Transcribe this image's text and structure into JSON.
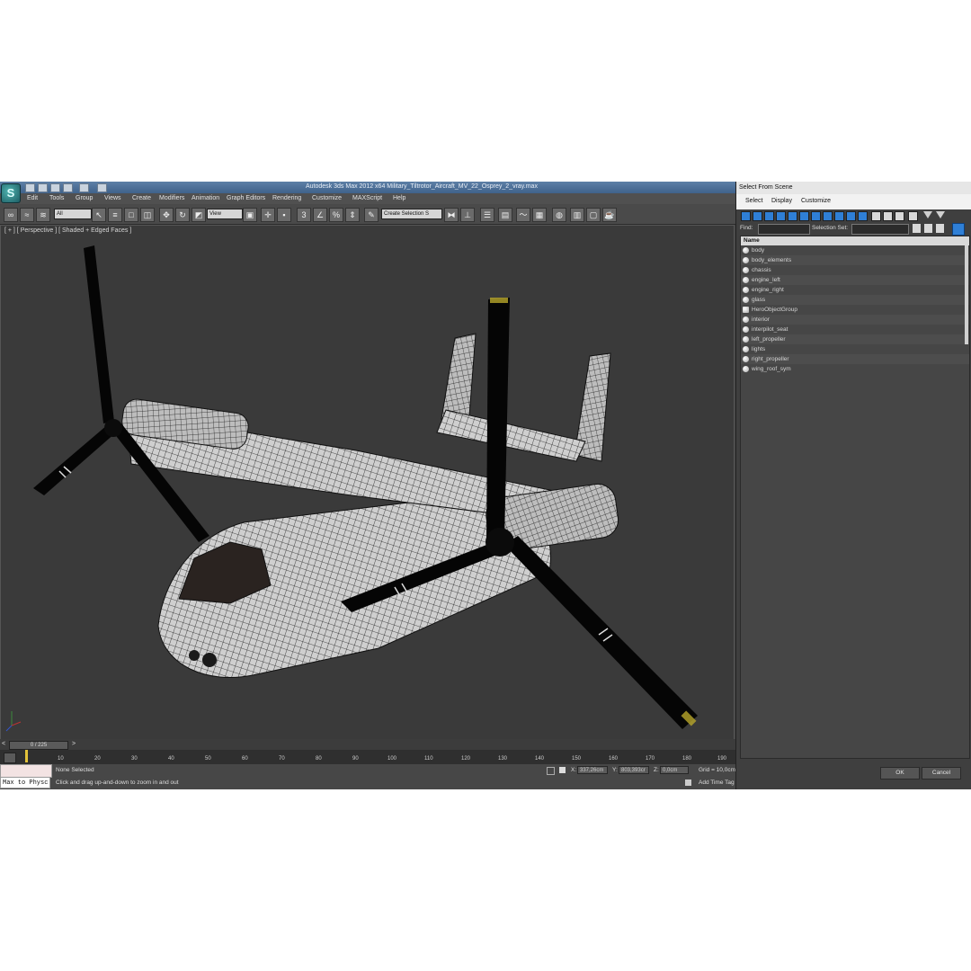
{
  "window": {
    "title": "Autodesk 3ds Max 2012 x64      Military_Tiltrotor_Aircraft_MV_22_Osprey_2_vray.max"
  },
  "menu": [
    "Edit",
    "Tools",
    "Group",
    "Views",
    "Create",
    "Modifiers",
    "Animation",
    "Graph Editors",
    "Rendering",
    "Customize",
    "MAXScript",
    "Help"
  ],
  "toolbar": {
    "filter_value": "All",
    "reference_coord": "View",
    "named_selection_placeholder": "Create Selection S"
  },
  "viewport": {
    "label": "[ + ] [ Perspective ] [ Shaded + Edged Faces ]"
  },
  "timeline": {
    "slider_text": "0 / 225",
    "ticks": [
      "10",
      "20",
      "30",
      "40",
      "50",
      "60",
      "70",
      "80",
      "90",
      "100",
      "110",
      "120",
      "130",
      "140",
      "150",
      "160",
      "170",
      "180",
      "190"
    ]
  },
  "status": {
    "selection": "None Selected",
    "prompt": "Click and drag up-and-down to zoom in and out",
    "maxscript_text": "Max to Physc",
    "x_label": "X:",
    "x_value": "337,26cm",
    "y_label": "Y:",
    "y_value": "803,393cr",
    "z_label": "Z:",
    "z_value": "0,0cm",
    "grid": "Grid = 10,0cm",
    "add_time_tag": "Add Time Tag"
  },
  "dialog": {
    "title": "Select From Scene",
    "menu": [
      "Select",
      "Display",
      "Customize"
    ],
    "find_label": "Find:",
    "selection_set_label": "Selection Set:",
    "column_header": "Name",
    "items": [
      "body",
      "body_elements",
      "chassis",
      "engine_left",
      "engine_right",
      "glass",
      "HeroObjectGroup",
      "interior",
      "interpilot_seat",
      "left_propeller",
      "lights",
      "right_propeller",
      "wing_roof_sym"
    ],
    "ok_label": "OK",
    "cancel_label": "Cancel"
  },
  "colors": {
    "title_bar": "#4a6c94",
    "viewport_bg": "#3a3a3a",
    "ui_dark": "#444444",
    "dialog_toolbar_accent": "#2f7fd6"
  }
}
